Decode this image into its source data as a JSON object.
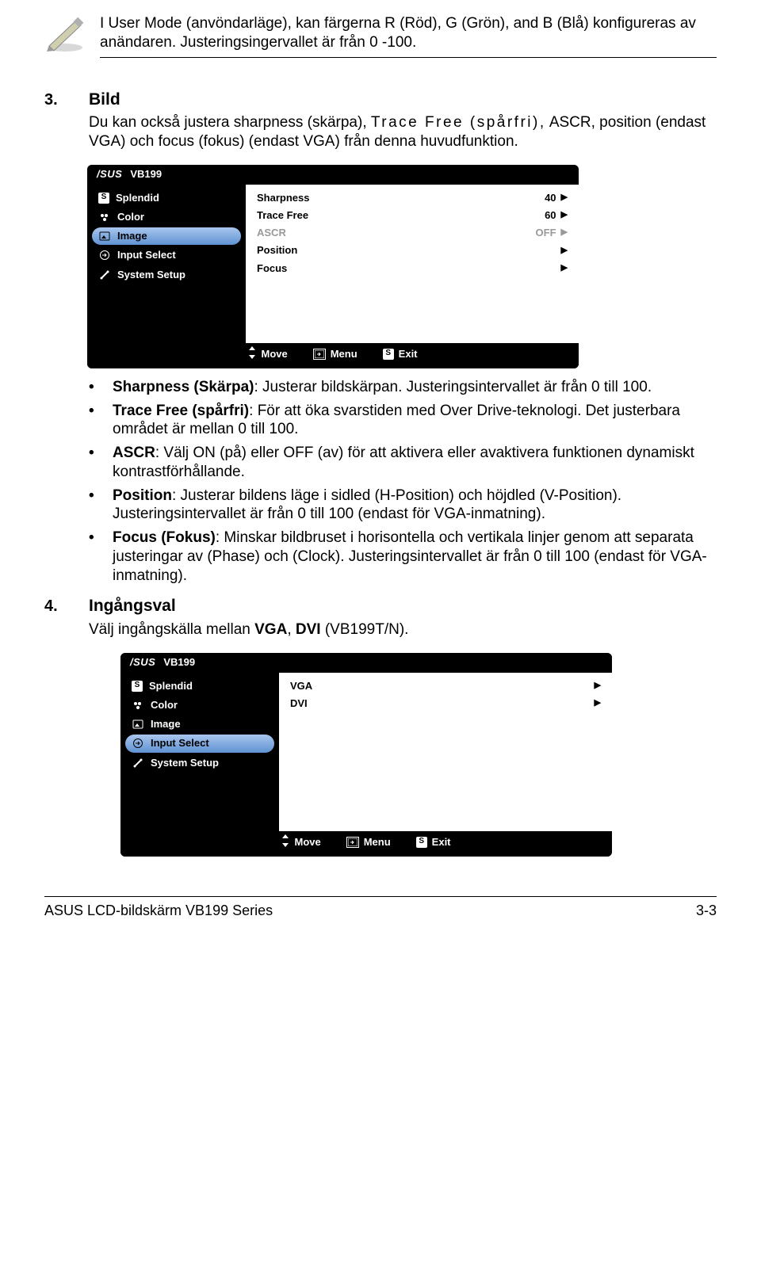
{
  "note": {
    "text": "I User Mode (anvöndarläge), kan färgerna R (Röd), G (Grön), and B (Blå) konfigureras av anändaren. Justeringsingervallet är från 0 -100."
  },
  "section3": {
    "num": "3.",
    "title": "Bild",
    "intro_a": "Du kan också justera sharpness (skärpa), ",
    "intro_b": "Trace Free (spårfri),",
    "intro_c": " ASCR, position (endast VGA) och focus (fokus) (endast VGA) från denna huvudfunktion."
  },
  "osd1": {
    "model": "VB199",
    "left": {
      "splendid": "Splendid",
      "color": "Color",
      "image": "Image",
      "input": "Input Select",
      "system": "System Setup"
    },
    "right": {
      "sharpness_label": "Sharpness",
      "sharpness_val": "40",
      "trace_label": "Trace Free",
      "trace_val": "60",
      "ascr_label": "ASCR",
      "ascr_val": "OFF",
      "position_label": "Position",
      "focus_label": "Focus"
    },
    "footer": {
      "move": "Move",
      "menu": "Menu",
      "exit": "Exit"
    }
  },
  "bullets3": {
    "b1_bold": "Sharpness (Skärpa)",
    "b1_rest": ": Justerar bildskärpan. Justeringsintervallet är från 0 till 100.",
    "b2_bold": "Trace Free (spårfri)",
    "b2_rest": ": För att öka svarstiden med Over Drive-teknologi. Det justerbara området är mellan 0 till 100.",
    "b3_bold": "ASCR",
    "b3_rest": ": Välj ON (på) eller OFF (av) för att aktivera eller avaktivera funktionen dynamiskt kontrastförhållande.",
    "b4_bold": "Position",
    "b4_rest": ": Justerar bildens läge i sidled (H-Position) och höjdled (V-Position). Justeringsintervallet är från 0 till 100 (endast för VGA-inmatning).",
    "b5_bold": "Focus (Fokus)",
    "b5_rest": ": Minskar bildbruset i horisontella och vertikala linjer genom att separata justeringar av (Phase) och (Clock). Justeringsintervallet är från 0 till 100 (endast för VGA-inmatning)."
  },
  "section4": {
    "num": "4.",
    "title": "Ingångsval",
    "intro_a": "Välj ingångskälla mellan ",
    "intro_vga": "VGA",
    "intro_sep": ", ",
    "intro_dvi": "DVI",
    "intro_b": " (VB199T/N)."
  },
  "osd2": {
    "model": "VB199",
    "left": {
      "splendid": "Splendid",
      "color": "Color",
      "image": "Image",
      "input": "Input Select",
      "system": "System Setup"
    },
    "right": {
      "vga": "VGA",
      "dvi": "DVI"
    },
    "footer": {
      "move": "Move",
      "menu": "Menu",
      "exit": "Exit"
    }
  },
  "footer": {
    "left": "ASUS LCD-bildskärm VB199 Series",
    "right": "3-3"
  }
}
